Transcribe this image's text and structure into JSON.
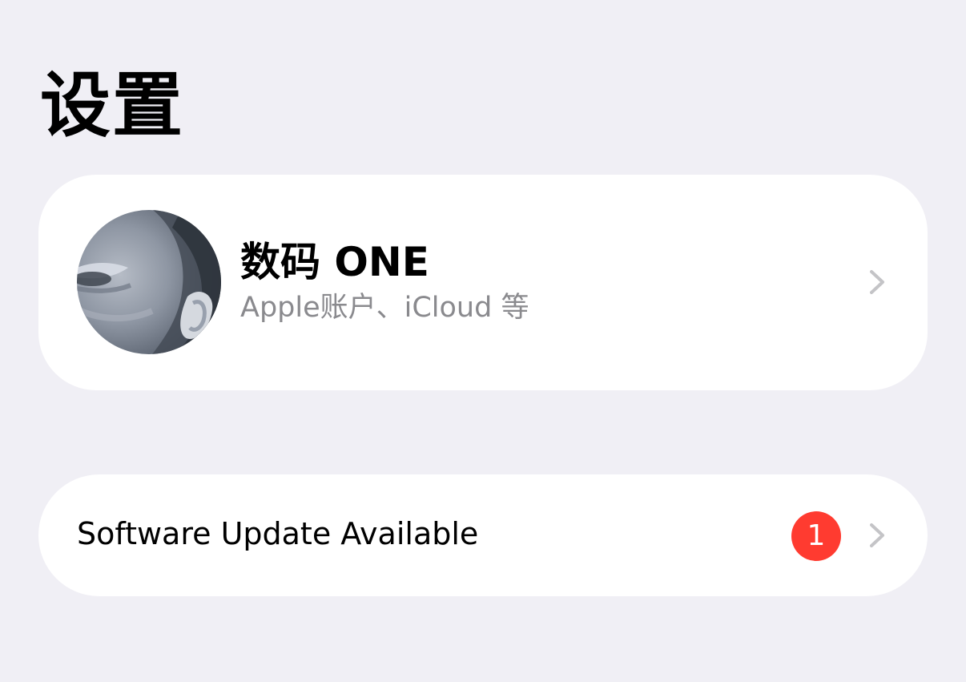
{
  "page": {
    "title": "设置"
  },
  "account": {
    "name": "数码 ONE",
    "subtitle": "Apple账户、iCloud 等",
    "avatar_icon": "person-photo-avatar",
    "chevron_icon": "chevron-right-icon"
  },
  "software_update": {
    "label": "Software Update Available",
    "badge_count": "1",
    "chevron_icon": "chevron-right-icon"
  },
  "colors": {
    "background": "#f0eff5",
    "card": "#ffffff",
    "primary_text": "#000000",
    "secondary_text": "#8a8a8e",
    "badge": "#ff3b30",
    "chevron": "#c4c4c7"
  }
}
